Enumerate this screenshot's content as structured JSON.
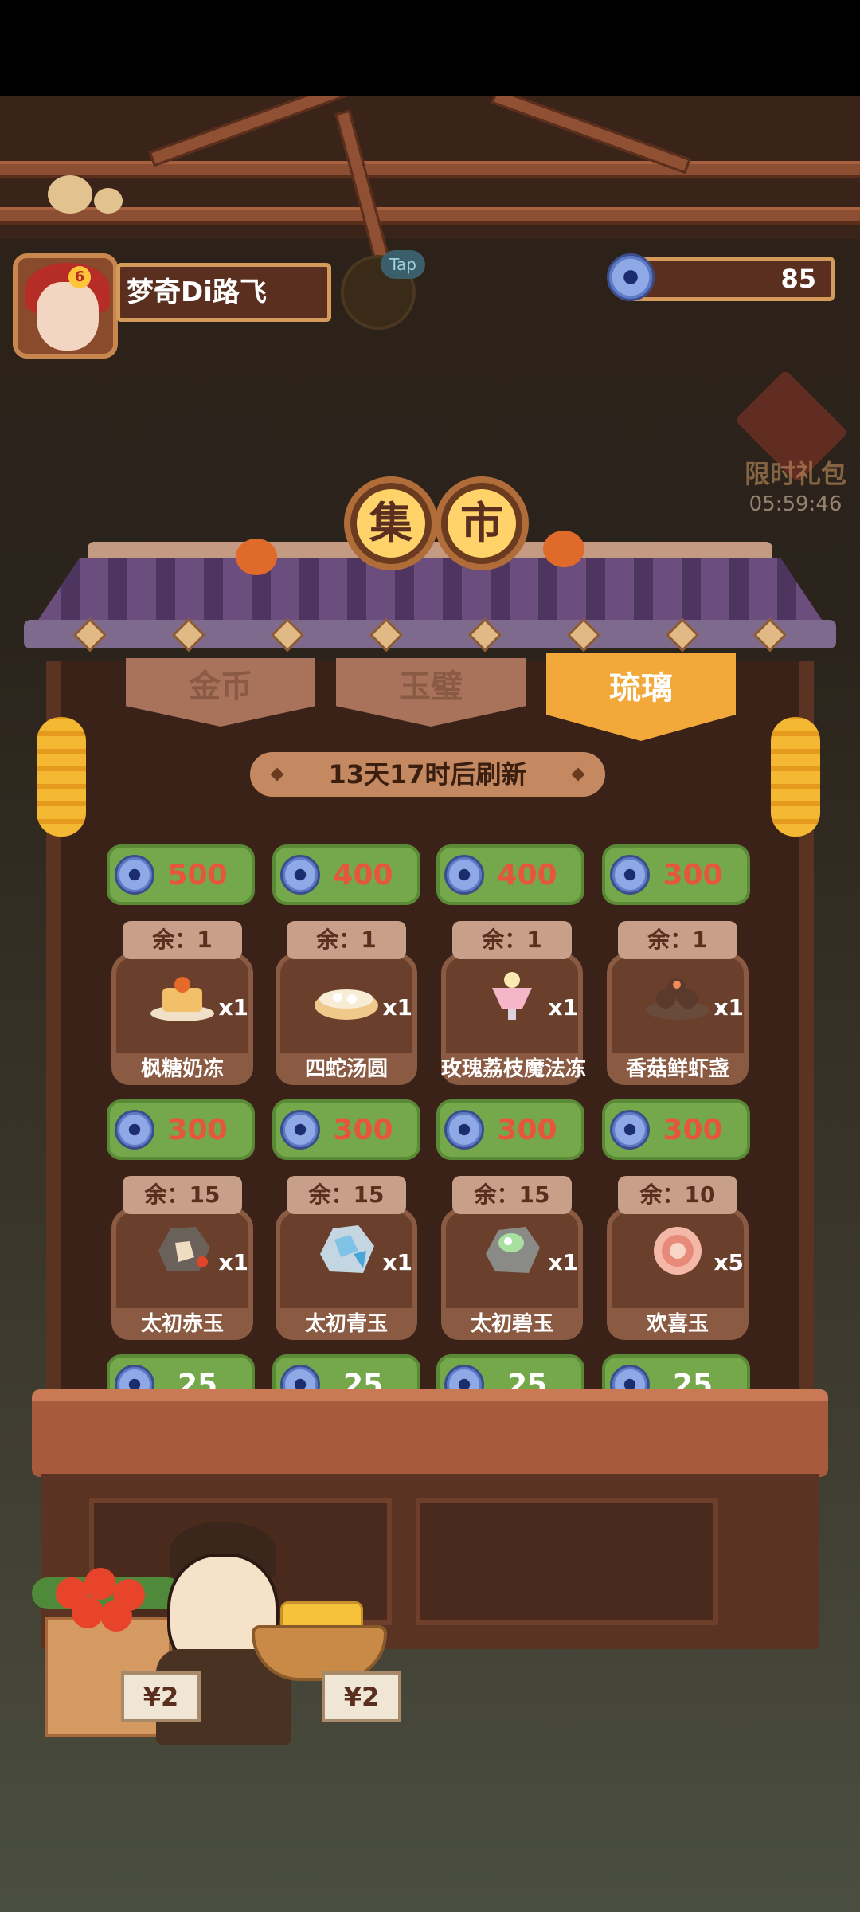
{
  "player": {
    "name": "梦奇Di路飞",
    "level_badge": "6"
  },
  "tap_label": "Tap",
  "currency": {
    "icon": "liuli-coin-icon",
    "amount": "85"
  },
  "limited_pack": {
    "label": "限时礼包",
    "timer": "05:59:46"
  },
  "stall": {
    "sign_chars": [
      "集",
      "市"
    ],
    "tabs": [
      {
        "label": "金币",
        "active": false
      },
      {
        "label": "玉璧",
        "active": false
      },
      {
        "label": "琉璃",
        "active": true
      }
    ],
    "refresh_text": "13天17时后刷新"
  },
  "shop": {
    "row1_prices": [
      "500",
      "400",
      "400",
      "300"
    ],
    "row1_items": [
      {
        "remaining": "余：1",
        "name": "枫糖奶冻",
        "qty": "x1",
        "icon": "maple-pudding-icon"
      },
      {
        "remaining": "余：1",
        "name": "四蛇汤圆",
        "qty": "x1",
        "icon": "soup-dumplings-icon"
      },
      {
        "remaining": "余：1",
        "name": "玫瑰荔枝魔法冻",
        "qty": "x1",
        "icon": "lychee-jelly-icon"
      },
      {
        "remaining": "余：1",
        "name": "香菇鲜虾盏",
        "qty": "x1",
        "icon": "shrimp-mushroom-cups-icon"
      }
    ],
    "row2_prices": [
      "300",
      "300",
      "300",
      "300"
    ],
    "row2_items": [
      {
        "remaining": "余：15",
        "name": "太初赤玉",
        "qty": "x1",
        "icon": "red-jade-ore-icon"
      },
      {
        "remaining": "余：15",
        "name": "太初青玉",
        "qty": "x1",
        "icon": "blue-jade-ore-icon"
      },
      {
        "remaining": "余：15",
        "name": "太初碧玉",
        "qty": "x1",
        "icon": "green-jade-ore-icon"
      },
      {
        "remaining": "余：10",
        "name": "欢喜玉",
        "qty": "x5",
        "icon": "joy-jade-icon"
      }
    ],
    "row3_prices": [
      "25",
      "25",
      "25",
      "25"
    ]
  },
  "counter_labels": [
    "¥2",
    "¥2"
  ],
  "colors": {
    "price_button": "#75a84b",
    "price_text": "#e6553d",
    "active_tab": "#f3a83a"
  }
}
